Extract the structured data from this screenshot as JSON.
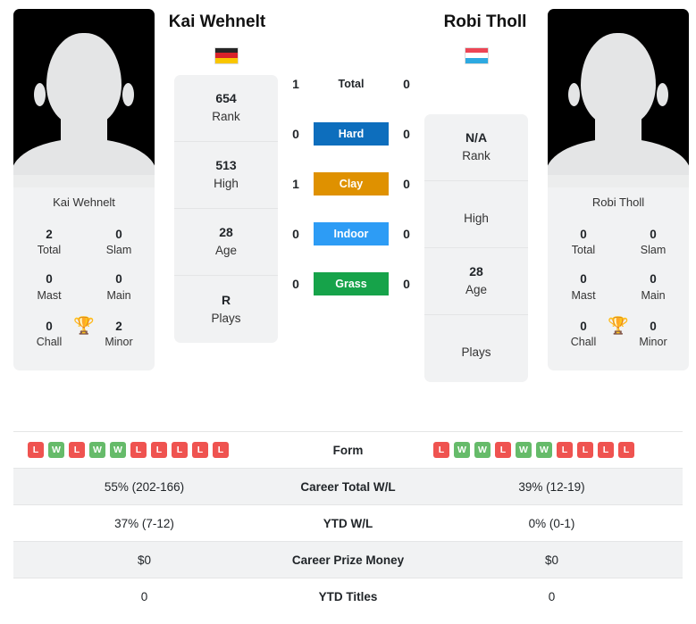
{
  "players": {
    "left": {
      "name": "Kai Wehnelt",
      "card_name": "Kai Wehnelt",
      "flag_name": "germany-flag",
      "flag_colors": [
        "#262626",
        "#D8232A",
        "#F9C600"
      ],
      "stats": [
        {
          "value": "654",
          "label": "Rank"
        },
        {
          "value": "513",
          "label": "High"
        },
        {
          "value": "28",
          "label": "Age"
        },
        {
          "value": "R",
          "label": "Plays"
        }
      ],
      "titles": [
        {
          "value": "2",
          "label": "Total"
        },
        {
          "value": "0",
          "label": "Slam"
        },
        {
          "value": "0",
          "label": "Mast"
        },
        {
          "value": "0",
          "label": "Main"
        },
        {
          "value": "0",
          "label": "Chall"
        },
        {
          "value": "2",
          "label": "Minor"
        }
      ],
      "form": [
        "L",
        "W",
        "L",
        "W",
        "W",
        "L",
        "L",
        "L",
        "L",
        "L"
      ]
    },
    "right": {
      "name": "Robi Tholl",
      "card_name": "Robi Tholl",
      "flag_name": "luxembourg-flag",
      "flag_colors": [
        "#ED4555",
        "#FFFFFF",
        "#2DA9E1"
      ],
      "stats": [
        {
          "value": "N/A",
          "label": "Rank"
        },
        {
          "value": "",
          "label": "High"
        },
        {
          "value": "28",
          "label": "Age"
        },
        {
          "value": "",
          "label": "Plays"
        }
      ],
      "titles": [
        {
          "value": "0",
          "label": "Total"
        },
        {
          "value": "0",
          "label": "Slam"
        },
        {
          "value": "0",
          "label": "Mast"
        },
        {
          "value": "0",
          "label": "Main"
        },
        {
          "value": "0",
          "label": "Chall"
        },
        {
          "value": "0",
          "label": "Minor"
        }
      ],
      "form": [
        "L",
        "W",
        "W",
        "L",
        "W",
        "W",
        "L",
        "L",
        "L",
        "L"
      ]
    }
  },
  "h2h": [
    {
      "label": "Total",
      "left": "1",
      "right": "0",
      "color": "",
      "plain": true
    },
    {
      "label": "Hard",
      "left": "0",
      "right": "0",
      "color": "#0D6EBD",
      "plain": false
    },
    {
      "label": "Clay",
      "left": "1",
      "right": "0",
      "color": "#DF9100",
      "plain": false
    },
    {
      "label": "Indoor",
      "left": "0",
      "right": "0",
      "color": "#2D9CF5",
      "plain": false
    },
    {
      "label": "Grass",
      "left": "0",
      "right": "0",
      "color": "#16A34A",
      "plain": false
    }
  ],
  "table": {
    "form_label": "Form",
    "rows": [
      {
        "label": "Career Total W/L",
        "left": "55% (202-166)",
        "right": "39% (12-19)"
      },
      {
        "label": "YTD W/L",
        "left": "37% (7-12)",
        "right": "0% (0-1)"
      },
      {
        "label": "Career Prize Money",
        "left": "$0",
        "right": "$0"
      },
      {
        "label": "YTD Titles",
        "left": "0",
        "right": "0"
      }
    ]
  },
  "icons": {
    "trophy": "🏆"
  }
}
